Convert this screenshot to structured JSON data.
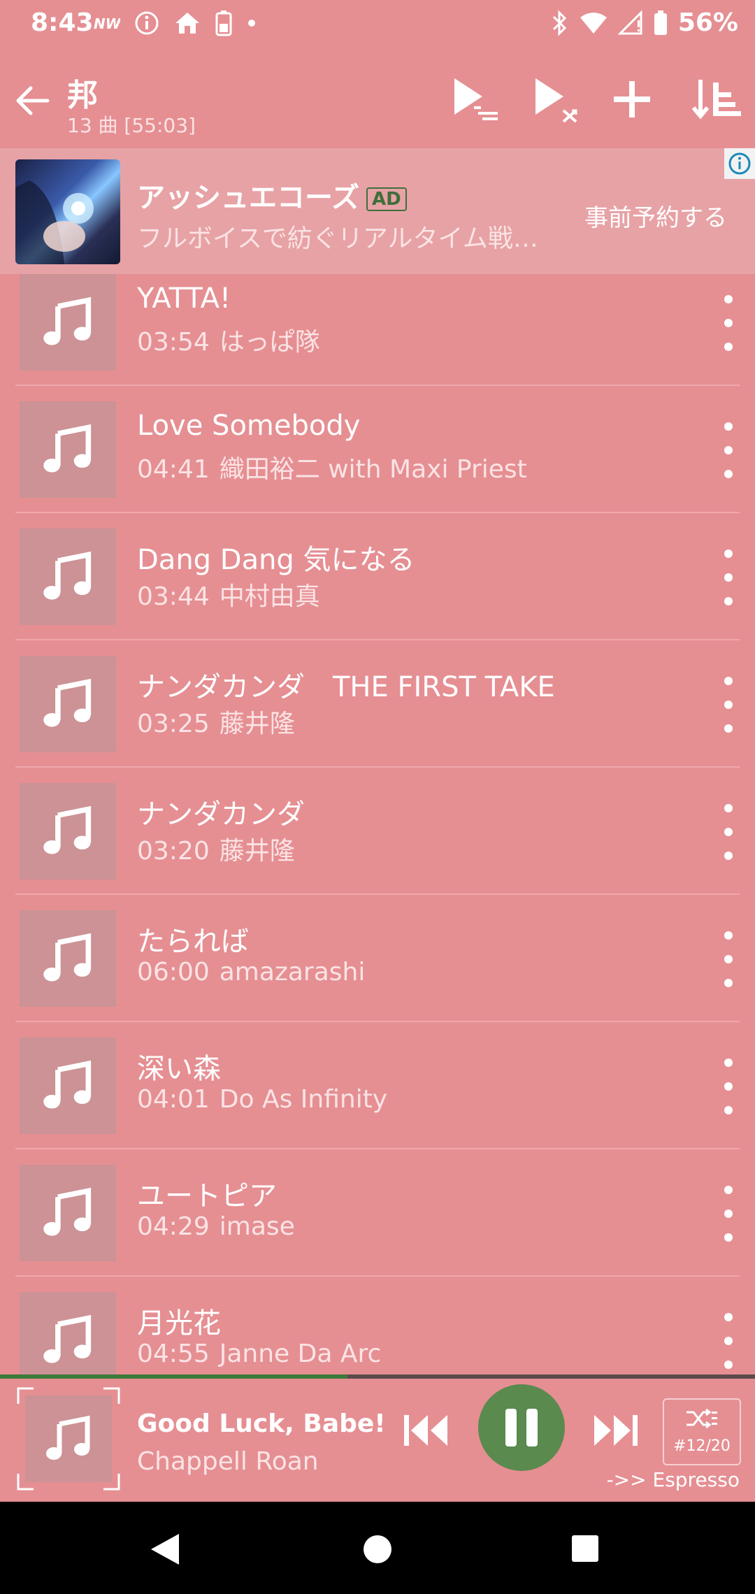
{
  "status": {
    "time": "8:43",
    "battery": "56%"
  },
  "header": {
    "title": "邦",
    "subtitle": "13 曲 [55:03]"
  },
  "ad": {
    "title": "アッシュエコーズ",
    "badge": "AD",
    "description": "フルボイスで紡ぐリアルタイム戦…",
    "cta": "事前予約する"
  },
  "songs": [
    {
      "title": "YATTA!",
      "duration": "03:54",
      "artist": "はっぱ隊"
    },
    {
      "title": "Love Somebody",
      "duration": "04:41",
      "artist": "織田裕二 with Maxi Priest"
    },
    {
      "title": "Dang Dang 気になる",
      "duration": "03:44",
      "artist": "中村由真"
    },
    {
      "title": "ナンダカンダ　THE FIRST TAKE",
      "duration": "03:25",
      "artist": "藤井隆"
    },
    {
      "title": "ナンダカンダ",
      "duration": "03:20",
      "artist": "藤井隆"
    },
    {
      "title": "たられば",
      "duration": "06:00",
      "artist": "amazarashi"
    },
    {
      "title": "深い森",
      "duration": "04:01",
      "artist": "Do As Infinity"
    },
    {
      "title": "ユートピア",
      "duration": "04:29",
      "artist": "imase"
    },
    {
      "title": "月光花",
      "duration": "04:55",
      "artist": "Janne Da Arc"
    }
  ],
  "player": {
    "title": "Good Luck, Babe!",
    "artist": "Chappell Roan",
    "queue_position": "#12/20",
    "next": "->> Espresso",
    "progress": 0.46
  },
  "colors": {
    "background": "#e58f93",
    "accent": "#5a8a4e",
    "progress": "#3c7a3a"
  }
}
